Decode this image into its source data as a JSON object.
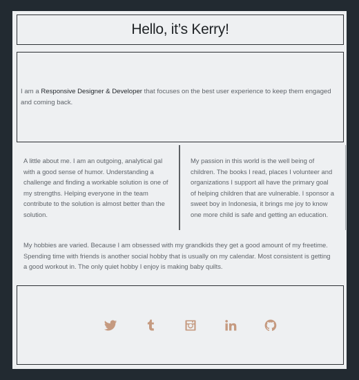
{
  "header": {
    "title": "Hello, it’s Kerry!"
  },
  "intro": {
    "prefix": "I am a ",
    "highlight": "Responsive Designer & Developer",
    "suffix": " that focuses on the best user experience to keep them engaged and coming back."
  },
  "about": {
    "left": "A little about me. I am an outgoing, analytical gal with a good sense of humor. Understanding a challenge and finding a workable solution is one of my strengths. Helping everyone in the team contribute to the solution is almost better than the solution.",
    "right": "My passion in this world is the well being of children. The books I read, places I volunteer and organizations I support all have the primary goal of helping children that are vulnerable. I sponsor a sweet boy in Indonesia, it brings me joy to know one more child is safe and getting an education."
  },
  "hobbies": "My hobbies are varied. Because I am obsessed with my grandkids they get a good amount of my freetime. Spending time with friends is another social hobby that is usually on my calendar. Most consistent is getting a good workout in. The only quiet hobby I enjoy is making baby quilts.",
  "social": {
    "icons": [
      "twitter-icon",
      "tumblr-icon",
      "instagram-icon",
      "linkedin-icon",
      "github-icon"
    ],
    "icon_color": "#c59a80"
  },
  "colors": {
    "background": "#222a31",
    "panel": "#eef0f2",
    "accent": "#c59a80"
  }
}
